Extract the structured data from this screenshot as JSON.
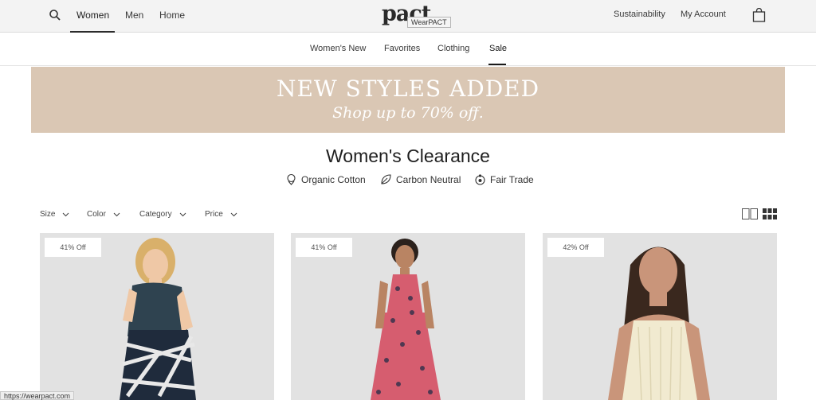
{
  "header": {
    "nav": [
      "Women",
      "Men",
      "Home"
    ],
    "logo": "pact",
    "tooltip": "WearPACT",
    "sustainability": "Sustainability",
    "account": "My Account"
  },
  "categories": [
    "Women's New",
    "Favorites",
    "Clothing",
    "Sale"
  ],
  "banner": {
    "title": "NEW STYLES ADDED",
    "subtitle": "Shop up to 70% off."
  },
  "page": {
    "title": "Women's Clearance",
    "badges": [
      "Organic Cotton",
      "Carbon Neutral",
      "Fair Trade"
    ]
  },
  "filters": [
    "Size",
    "Color",
    "Category",
    "Price"
  ],
  "products": [
    {
      "discount": "41% Off"
    },
    {
      "discount": "41% Off"
    },
    {
      "discount": "42% Off"
    }
  ],
  "status_url": "https://wearpact.com",
  "colors": {
    "banner": "#dac7b4",
    "header": "#f3f3f3"
  }
}
